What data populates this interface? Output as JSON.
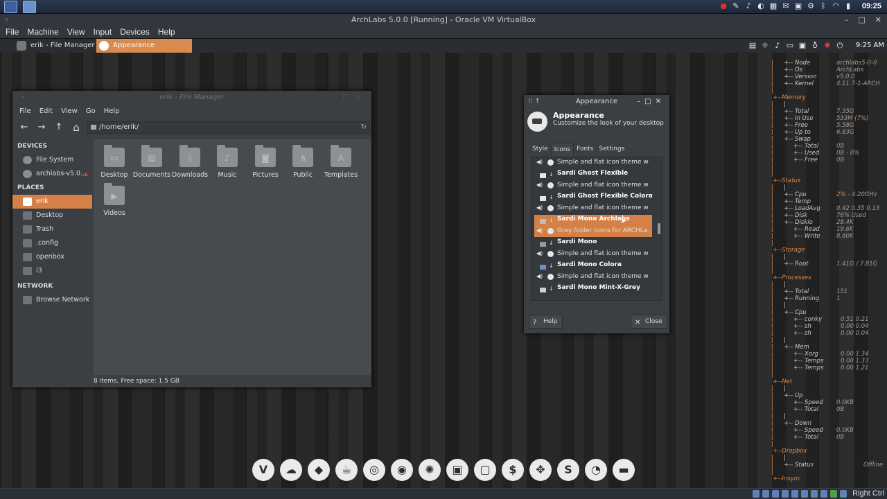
{
  "host": {
    "clock": "09:25"
  },
  "vbox": {
    "title": "ArchLabs 5.0.0 [Running] - Oracle VM VirtualBox",
    "menu": [
      "File",
      "Machine",
      "View",
      "Input",
      "Devices",
      "Help"
    ]
  },
  "guest_panel": {
    "tasks": [
      "erik - File Manager",
      "Appearance"
    ],
    "clock": "9:25 AM"
  },
  "file_manager": {
    "title": "erik - File Manager",
    "menu": [
      "File",
      "Edit",
      "View",
      "Go",
      "Help"
    ],
    "path": "/home/erik/",
    "sidebar": {
      "devices_header": "DEVICES",
      "devices": [
        "File System",
        "archlabs-v5.0..."
      ],
      "places_header": "PLACES",
      "places": [
        "erik",
        "Desktop",
        "Trash",
        ".config",
        "openbox",
        "i3"
      ],
      "network_header": "NETWORK",
      "network": [
        "Browse Network"
      ]
    },
    "files": [
      "Desktop",
      "Documents",
      "Downloads",
      "Music",
      "Pictures",
      "Public",
      "Templates",
      "Videos"
    ],
    "status": "8 items, Free space: 1.5 GB"
  },
  "appearance": {
    "title": "Appearance",
    "heading": "Appearance",
    "subheading": "Customize the look of your desktop",
    "tabs": [
      "Style",
      "Icons",
      "Fonts",
      "Settings"
    ],
    "active_tab": "Icons",
    "themes": [
      {
        "name": "",
        "desc": "Simple and flat icon theme wi..."
      },
      {
        "name": "Sardi Ghost Flexible",
        "desc": "Simple and flat icon theme wi..."
      },
      {
        "name": "Sardi Ghost Flexible Colora",
        "desc": "Simple and flat icon theme wi..."
      },
      {
        "name": "Sardi Mono Archlabs",
        "desc": "Grey folder icons for ARCHLa..."
      },
      {
        "name": "Sardi Mono",
        "desc": "Simple and flat icon theme wi..."
      },
      {
        "name": "Sardi Mono Colora",
        "desc": "Simple and flat icon theme wi..."
      },
      {
        "name": "Sardi Mono Mint-X-Grey",
        "desc": ""
      }
    ],
    "selected_theme": "Sardi Mono Archlabs",
    "help_label": "Help",
    "close_label": "Close"
  },
  "conky": {
    "lines": [
      {
        "l": "+-- Node",
        "v": "archlabs5-0-0",
        "i": 1
      },
      {
        "l": "+-- Os",
        "v": "ArchLabs",
        "i": 1
      },
      {
        "l": "+-- Version",
        "v": "v5.0.0",
        "i": 1
      },
      {
        "l": "+-- Kernel",
        "v": "4.11.7-1-ARCH",
        "i": 1
      },
      {
        "l": "",
        "v": "",
        "i": 1
      },
      {
        "l": "+--Memory",
        "v": "",
        "i": 0,
        "sec": true
      },
      {
        "l": "|",
        "v": "",
        "i": 1
      },
      {
        "l": "+-- Total",
        "v": "7.35G",
        "i": 1
      },
      {
        "l": "+-- In Use",
        "v": "533M",
        "hl": "(7%)",
        "i": 1
      },
      {
        "l": "+-- Free",
        "v": "5.58G",
        "i": 1
      },
      {
        "l": "+-- Up to",
        "v": "6.83G",
        "i": 1
      },
      {
        "l": "+-- Swap",
        "v": "",
        "i": 1
      },
      {
        "l": "+-- Total",
        "v": "0B",
        "i": 2
      },
      {
        "l": "+-- Used",
        "v": "0B - 0%",
        "i": 2
      },
      {
        "l": "+-- Free",
        "v": "0B",
        "i": 2
      },
      {
        "l": "",
        "v": "",
        "i": 1
      },
      {
        "l": "",
        "v": "",
        "i": 1
      },
      {
        "l": "+--Status",
        "v": "",
        "i": 0,
        "sec": true
      },
      {
        "l": "|",
        "v": "",
        "i": 1
      },
      {
        "l": "+-- Cpu",
        "v": "",
        "hl": "2%",
        "v2": " - 4.20GHz",
        "i": 1
      },
      {
        "l": "+-- Temp",
        "v": "",
        "i": 1
      },
      {
        "l": "+-- LoadAvg",
        "v": "0.42 0.35 0.13",
        "i": 1
      },
      {
        "l": "+-- Disk",
        "v": "76% Used",
        "i": 1
      },
      {
        "l": "+-- Diskio",
        "v": "28.4K",
        "i": 1
      },
      {
        "l": "+-- Read",
        "v": "19.6K",
        "i": 2
      },
      {
        "l": "+-- Write",
        "v": "8.80K",
        "i": 2
      },
      {
        "l": "",
        "v": "",
        "i": 1
      },
      {
        "l": "+--Storage",
        "v": "",
        "i": 0,
        "sec": true
      },
      {
        "l": "|",
        "v": "",
        "i": 1
      },
      {
        "l": "+-- Root",
        "v": "1.41G / 7.81G",
        "i": 1
      },
      {
        "l": "",
        "v": "",
        "i": 1
      },
      {
        "l": "+--Processes",
        "v": "",
        "i": 0,
        "sec": true
      },
      {
        "l": "|",
        "v": "",
        "i": 1
      },
      {
        "l": "+-- Total",
        "v": "151",
        "i": 1
      },
      {
        "l": "+-- Running",
        "v": "1",
        "i": 1
      },
      {
        "l": "|",
        "v": "",
        "i": 1
      },
      {
        "l": "+-- Cpu",
        "v": "",
        "i": 1
      },
      {
        "l": "+-- conky",
        "v": "0.51 0.21",
        "i": 2,
        "c": 1
      },
      {
        "l": "+-- sh",
        "v": "0.00 0.04",
        "i": 2,
        "c": 1
      },
      {
        "l": "+-- sh",
        "v": "0.00 0.04",
        "i": 2,
        "c": 1
      },
      {
        "l": "|",
        "v": "",
        "i": 1
      },
      {
        "l": "+-- Mem",
        "v": "",
        "i": 1
      },
      {
        "l": "+-- Xorg",
        "v": "0.00 1.34",
        "i": 2,
        "c": 1
      },
      {
        "l": "+-- Temps",
        "v": "0.00 1.33",
        "i": 2,
        "c": 1
      },
      {
        "l": "+-- Temps",
        "v": "0.00 1.21",
        "i": 2,
        "c": 1
      },
      {
        "l": "",
        "v": "",
        "i": 1
      },
      {
        "l": "+--Net",
        "v": "",
        "i": 0,
        "sec": true
      },
      {
        "l": "|",
        "v": "",
        "i": 1
      },
      {
        "l": "+-- Up",
        "v": "",
        "i": 1
      },
      {
        "l": "+-- Speed",
        "v": "0.0KB",
        "i": 2
      },
      {
        "l": "+-- Total",
        "v": "0B",
        "i": 2
      },
      {
        "l": "|",
        "v": "",
        "i": 1
      },
      {
        "l": "+-- Down",
        "v": "",
        "i": 1
      },
      {
        "l": "+-- Speed",
        "v": "0.0KB",
        "i": 2
      },
      {
        "l": "+-- Total",
        "v": "0B",
        "i": 2
      },
      {
        "l": "",
        "v": "",
        "i": 1
      },
      {
        "l": "+--Dropbox",
        "v": "",
        "i": 0,
        "sec": true
      },
      {
        "l": "|",
        "v": "",
        "i": 1
      },
      {
        "l": "+-- Status",
        "v": "Offline",
        "i": 1,
        "right": true
      },
      {
        "l": "",
        "v": "",
        "i": 1
      },
      {
        "l": "+--Insync",
        "v": "",
        "i": 0,
        "sec": true
      }
    ]
  },
  "dock": {
    "icons": [
      "vivaldi-icon",
      "gnome-icon",
      "cat-icon",
      "teapot-icon",
      "debian-icon",
      "chrome-icon",
      "aperture-icon",
      "files-icon",
      "window-icon",
      "dollar-icon",
      "settings-icon",
      "s-icon",
      "firefox-icon",
      "appearance-icon"
    ],
    "glyphs": [
      "V",
      "☁",
      "◆",
      "☕",
      "◎",
      "◉",
      "✺",
      "▣",
      "▢",
      "$",
      "✥",
      "S",
      "◔",
      "▬"
    ]
  },
  "host_bottom": {
    "right_ctrl": "Right Ctrl"
  },
  "colors": {
    "accent": "#d58046",
    "window_bg": "#3b3e42",
    "conky_section": "#d98a4e"
  }
}
